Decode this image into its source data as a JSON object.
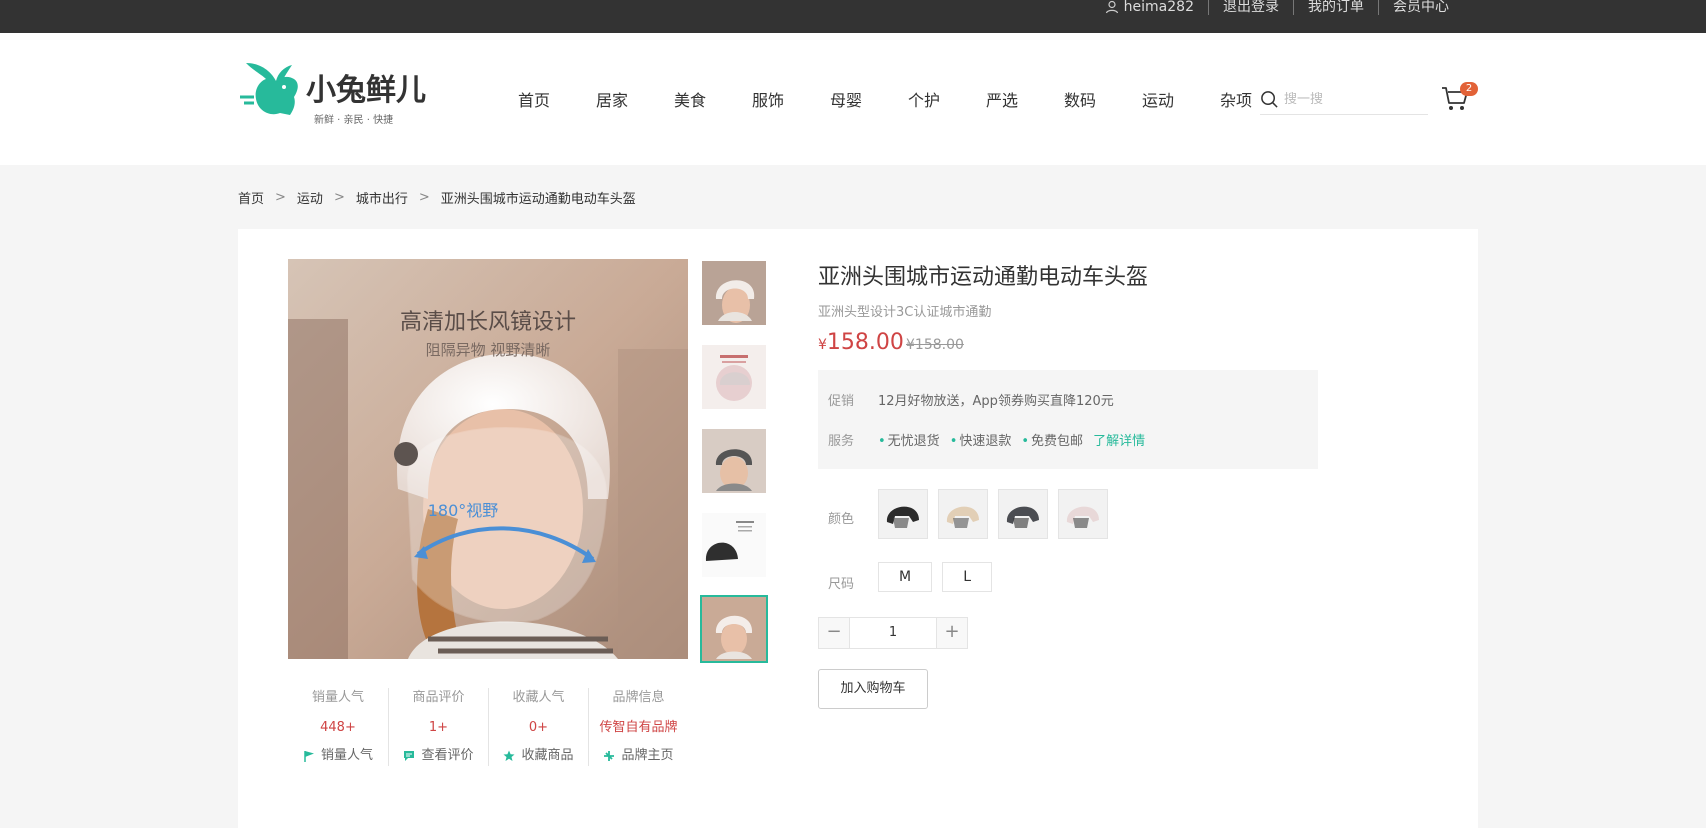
{
  "topbar": {
    "username": "heima282",
    "logout": "退出登录",
    "orders": "我的订单",
    "member": "会员中心"
  },
  "header": {
    "logo": {
      "brand": "小兔鲜儿",
      "slogan": "新鲜 · 亲民 · 快捷"
    },
    "nav": [
      "首页",
      "居家",
      "美食",
      "服饰",
      "母婴",
      "个护",
      "严选",
      "数码",
      "运动",
      "杂项"
    ],
    "search_placeholder": "搜一搜",
    "cart_count": "2"
  },
  "breadcrumb": [
    "首页",
    "运动",
    "城市出行",
    "亚洲头围城市运动通勤电动车头盔"
  ],
  "gallery": {
    "main_text_1": "高清加长风镜设计",
    "main_text_2": "阻隔异物 视野清晰",
    "main_text_3": "180°视野",
    "thumbs": 5,
    "active_thumb": 5
  },
  "stats": [
    {
      "title": "销量人气",
      "value": "448+",
      "link": "销量人气",
      "icon": "flag-icon"
    },
    {
      "title": "商品评价",
      "value": "1+",
      "link": "查看评价",
      "icon": "comment-icon"
    },
    {
      "title": "收藏人气",
      "value": "0+",
      "link": "收藏商品",
      "icon": "star-icon"
    },
    {
      "title": "品牌信息",
      "value": "传智自有品牌",
      "link": "品牌主页",
      "icon": "brand-icon"
    }
  ],
  "product": {
    "name": "亚洲头围城市运动通勤电动车头盔",
    "desc": "亚洲头型设计3C认证城市通勤",
    "currency": "¥",
    "price": "158.00",
    "old_price": "¥158.00"
  },
  "promo": {
    "promo_label": "促销",
    "promo_text": "12月好物放送，App领券购买直降120元",
    "service_label": "服务",
    "services": [
      "无忧退货",
      "快速退款",
      "免费包邮"
    ],
    "service_link": "了解详情"
  },
  "sku": {
    "color_label": "颜色",
    "size_label": "尺码",
    "sizes": [
      "M",
      "L"
    ]
  },
  "quantity": {
    "value": "1",
    "minus": "−",
    "plus": "+"
  },
  "add_cart": "加入购物车",
  "colors": {
    "accent": "#27ba9b",
    "price": "#cf4444",
    "topbar": "#333333"
  }
}
